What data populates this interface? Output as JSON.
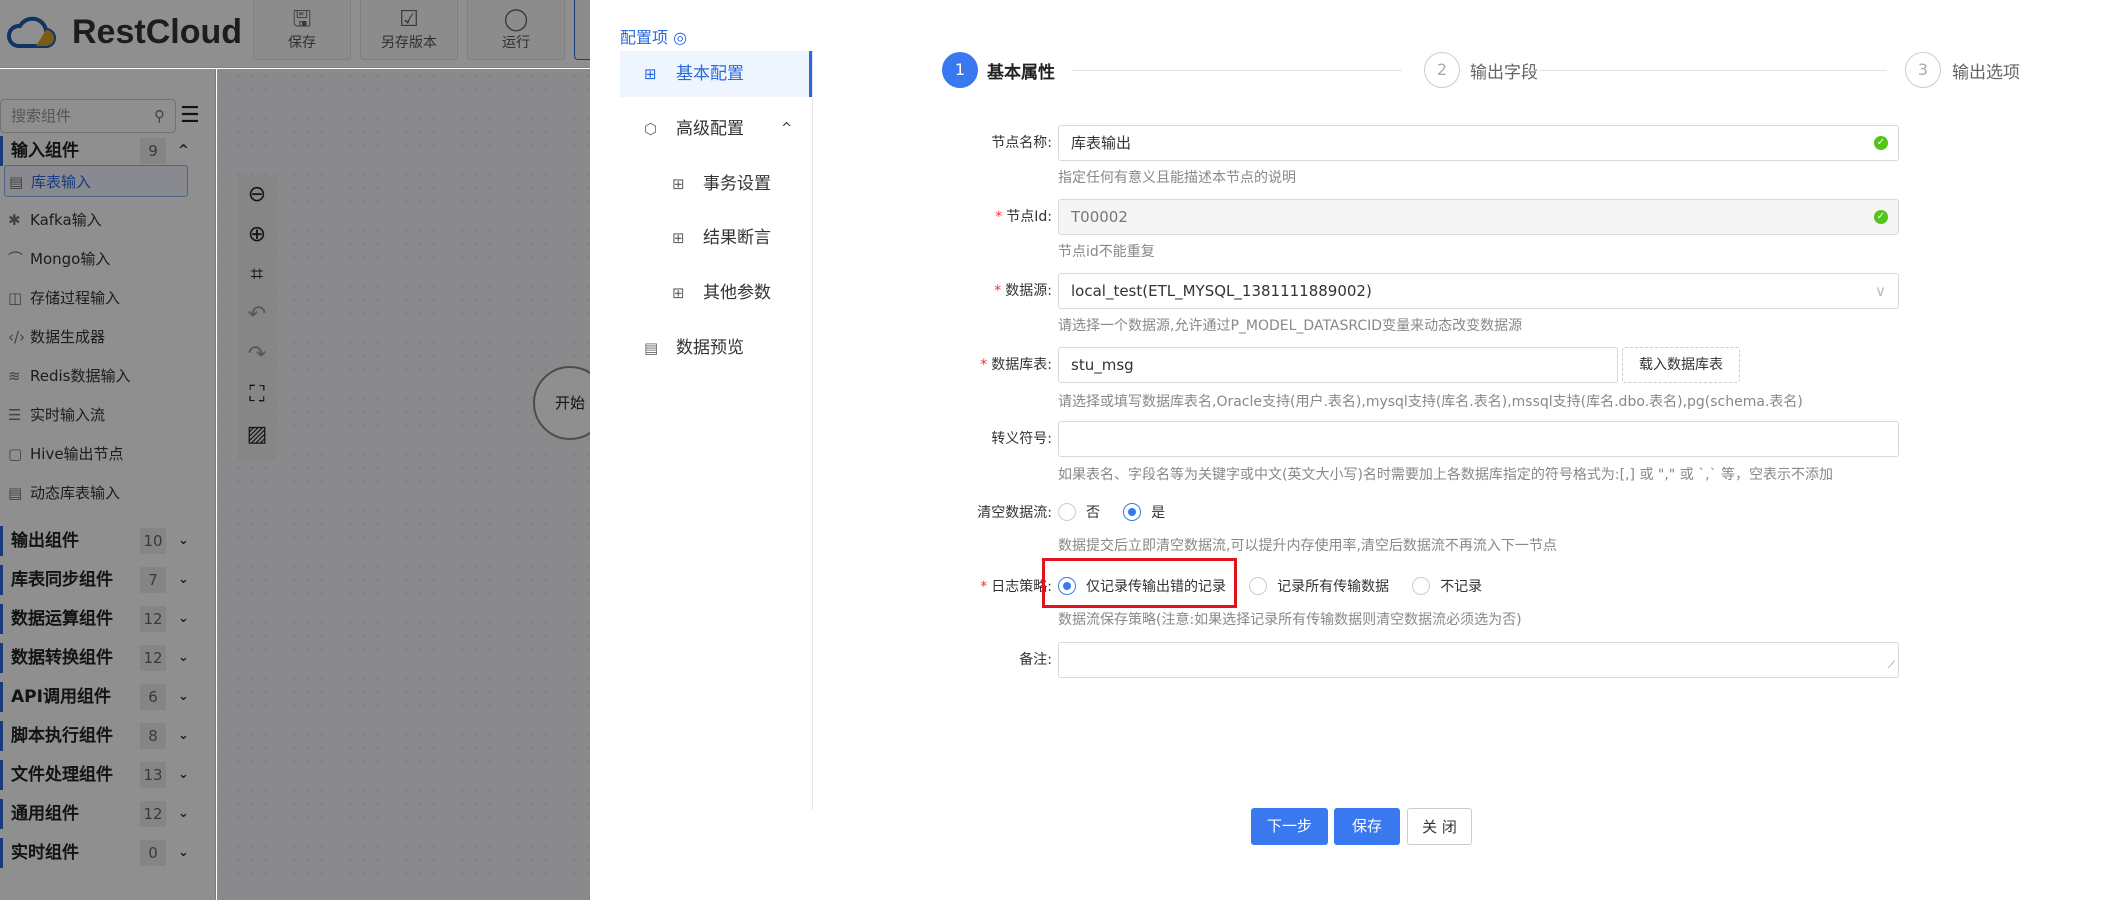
{
  "app": {
    "brand": "RestCloud",
    "toolbar": [
      {
        "label": "保存",
        "icon": "save-icon"
      },
      {
        "label": "另存版本",
        "icon": "save-version-icon"
      },
      {
        "label": "运行",
        "icon": "run-icon"
      }
    ]
  },
  "sidebar": {
    "search_placeholder": "搜索组件",
    "groups": [
      {
        "label": "输入组件",
        "count": "9",
        "expanded": true,
        "items": [
          {
            "label": "库表输入",
            "selected": true
          },
          {
            "label": "Kafka输入"
          },
          {
            "label": "Mongo输入"
          },
          {
            "label": "存储过程输入"
          },
          {
            "label": "数据生成器"
          },
          {
            "label": "Redis数据输入"
          },
          {
            "label": "实时输入流"
          },
          {
            "label": "Hive输出节点"
          },
          {
            "label": "动态库表输入"
          }
        ]
      },
      {
        "label": "输出组件",
        "count": "10"
      },
      {
        "label": "库表同步组件",
        "count": "7"
      },
      {
        "label": "数据运算组件",
        "count": "12"
      },
      {
        "label": "数据转换组件",
        "count": "12"
      },
      {
        "label": "API调用组件",
        "count": "6"
      },
      {
        "label": "脚本执行组件",
        "count": "8"
      },
      {
        "label": "文件处理组件",
        "count": "13"
      },
      {
        "label": "通用组件",
        "count": "12"
      },
      {
        "label": "实时组件",
        "count": "0"
      }
    ]
  },
  "canvas": {
    "start_node": "开始"
  },
  "panel": {
    "title": "配置项",
    "nav": [
      {
        "label": "基本配置",
        "active": true
      },
      {
        "label": "高级配置"
      },
      {
        "label": "事务设置"
      },
      {
        "label": "结果断言"
      },
      {
        "label": "其他参数"
      },
      {
        "label": "数据预览"
      }
    ],
    "steps": [
      {
        "num": "1",
        "label": "基本属性",
        "active": true
      },
      {
        "num": "2",
        "label": "输出字段"
      },
      {
        "num": "3",
        "label": "输出选项"
      }
    ],
    "form": {
      "node_name": {
        "label": "节点名称:",
        "value": "库表输出",
        "help": "指定任何有意义且能描述本节点的说明"
      },
      "node_id": {
        "label": "节点Id:",
        "value": "T00002",
        "help": "节点id不能重复"
      },
      "datasource": {
        "label": "数据源:",
        "value": "local_test(ETL_MYSQL_1381111889002)",
        "help": "请选择一个数据源,允许通过P_MODEL_DATASRCID变量来动态改变数据源"
      },
      "table": {
        "label": "数据库表:",
        "value": "stu_msg",
        "button": "载入数据库表",
        "help": "请选择或填写数据库表名,Oracle支持(用户.表名),mysql支持(库名.表名),mssql支持(库名.dbo.表名),pg(schema.表名)"
      },
      "escape": {
        "label": "转义符号:",
        "value": "",
        "help": "如果表名、字段名等为关键字或中文(英文大小写)名时需要加上各数据库指定的符号格式为:[,] 或 \",\" 或 `,` 等，空表示不添加"
      },
      "clear_stream": {
        "label": "清空数据流:",
        "options": [
          "否",
          "是"
        ],
        "selected": "是",
        "help": "数据提交后立即清空数据流,可以提升内存使用率,清空后数据流不再流入下一节点"
      },
      "log_policy": {
        "label": "日志策略:",
        "options": [
          "仅记录传输出错的记录",
          "记录所有传输数据",
          "不记录"
        ],
        "selected": "仅记录传输出错的记录",
        "help": "数据流保存策略(注意:如果选择记录所有传输数据则清空数据流必须选为否)"
      },
      "remark": {
        "label": "备注:",
        "value": ""
      }
    },
    "buttons": {
      "next": "下一步",
      "save": "保存",
      "close": "关 闭"
    }
  },
  "colors": {
    "accent": "#3a78f0",
    "highlight": "#e0141e"
  }
}
